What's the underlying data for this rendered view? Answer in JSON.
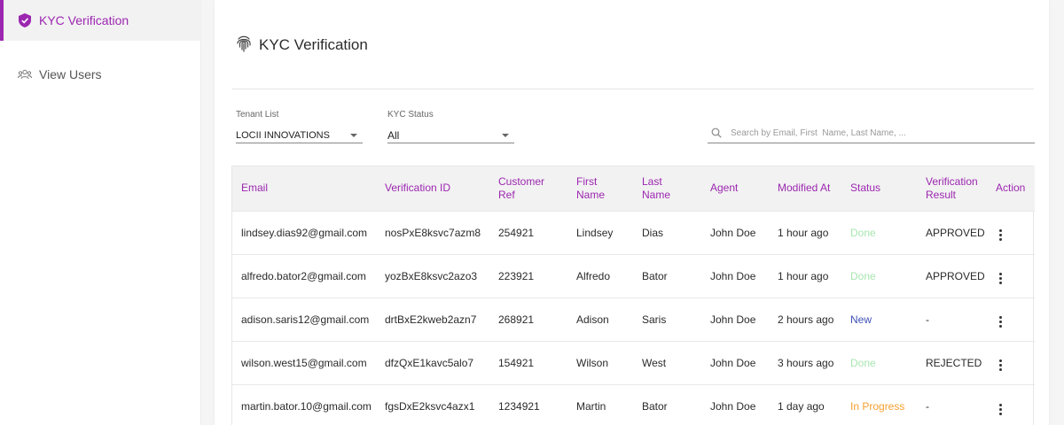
{
  "sidebar": {
    "items": [
      {
        "label": "KYC Verification",
        "icon": "shield-check-icon",
        "active": true
      },
      {
        "label": "View Users",
        "icon": "users-icon",
        "active": false
      }
    ]
  },
  "header": {
    "title": "KYC Verification",
    "icon": "fingerprint-icon"
  },
  "filters": {
    "tenant": {
      "label": "Tenant List",
      "value": "LOCII INNOVATIONS"
    },
    "kyc_status": {
      "label": "KYC Status",
      "value": "All"
    },
    "search": {
      "placeholder": "Search by Email, First  Name, Last Name, ...",
      "icon": "search-icon"
    }
  },
  "colors": {
    "accent": "#9c27b0",
    "done": "#a8e6b0",
    "new": "#3f51b5",
    "in_progress": "#f5a030"
  },
  "table": {
    "headers": {
      "email": "Email",
      "verification_id": "Verification ID",
      "customer_ref": "Customer Ref",
      "first_name": "First Name",
      "last_name": "Last Name",
      "agent": "Agent",
      "modified_at": "Modified At",
      "status": "Status",
      "verification_result": "Verification Result",
      "action": "Action"
    },
    "rows": [
      {
        "email": "lindsey.dias92@gmail.com",
        "verification_id": "nosPxE8ksvc7azm8",
        "customer_ref": "254921",
        "first_name": "Lindsey",
        "last_name": "Dias",
        "agent": "John Doe",
        "modified_at": "1 hour ago",
        "status": "Done",
        "verification_result": "APPROVED"
      },
      {
        "email": "alfredo.bator2@gmail.com",
        "verification_id": "yozBxE8ksvc2azo3",
        "customer_ref": "223921",
        "first_name": "Alfredo",
        "last_name": "Bator",
        "agent": "John Doe",
        "modified_at": "1 hour ago",
        "status": "Done",
        "verification_result": "APPROVED"
      },
      {
        "email": "adison.saris12@gmail.com",
        "verification_id": "drtBxE2kweb2azn7",
        "customer_ref": "268921",
        "first_name": "Adison",
        "last_name": "Saris",
        "agent": "John Doe",
        "modified_at": "2 hours ago",
        "status": "New",
        "verification_result": "-"
      },
      {
        "email": "wilson.west15@gmail.com",
        "verification_id": "dfzQxE1kavc5alo7",
        "customer_ref": "154921",
        "first_name": "Wilson",
        "last_name": "West",
        "agent": "John Doe",
        "modified_at": "3 hours ago",
        "status": "Done",
        "verification_result": "REJECTED"
      },
      {
        "email": "martin.bator.10@gmail.com",
        "verification_id": "fgsDxE2ksvc4azx1",
        "customer_ref": "1234921",
        "first_name": "Martin",
        "last_name": "Bator",
        "agent": "John Doe",
        "modified_at": "1 day ago",
        "status": "In Progress",
        "verification_result": "-"
      }
    ]
  }
}
